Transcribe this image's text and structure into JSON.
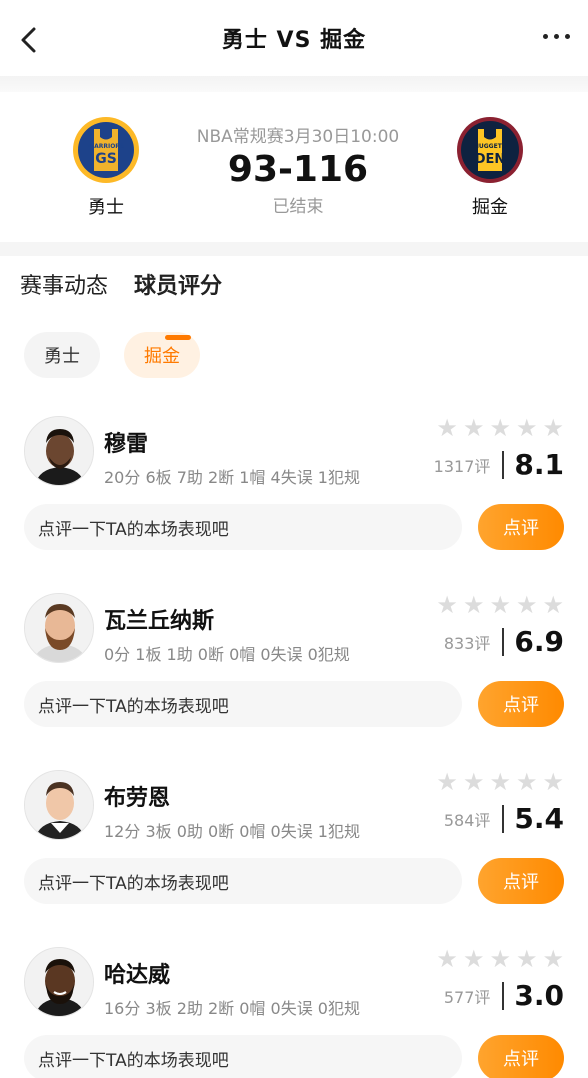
{
  "header": {
    "title": "勇士 VS 掘金"
  },
  "match": {
    "home_team": "勇士",
    "away_team": "掘金",
    "home_logo_text": "GS",
    "home_logo_small": "WARRIORS",
    "away_logo_text": "DEN",
    "away_logo_small": "NUGGETS",
    "meta": "NBA常规赛3月30日10:00",
    "score": "93-116",
    "status": "已结束"
  },
  "tabs": [
    {
      "label": "赛事动态",
      "active": false
    },
    {
      "label": "球员评分",
      "active": true
    }
  ],
  "team_filter": [
    {
      "label": "勇士",
      "active": false
    },
    {
      "label": "掘金",
      "active": true
    }
  ],
  "players": [
    {
      "name": "穆雷",
      "stats": "20分 6板 7助 2断 1帽 4失误 1犯规",
      "votes": "1317评",
      "rating": "8.1",
      "comment_placeholder": "点评一下TA的本场表现吧",
      "button": "点评"
    },
    {
      "name": "瓦兰丘纳斯",
      "stats": "0分 1板 1助 0断 0帽 0失误 0犯规",
      "votes": "833评",
      "rating": "6.9",
      "comment_placeholder": "点评一下TA的本场表现吧",
      "button": "点评"
    },
    {
      "name": "布劳恩",
      "stats": "12分 3板 0助 0断 0帽 0失误 1犯规",
      "votes": "584评",
      "rating": "5.4",
      "comment_placeholder": "点评一下TA的本场表现吧",
      "button": "点评"
    },
    {
      "name": "哈达威",
      "stats": "16分 3板 2助 2断 0帽 0失误 0犯规",
      "votes": "577评",
      "rating": "3.0",
      "comment_placeholder": "点评一下TA的本场表现吧",
      "button": "点评"
    }
  ],
  "colors": {
    "accent": "#ff7a00",
    "warriors_blue": "#1d428a",
    "warriors_gold": "#fdb927",
    "nuggets_navy": "#0e2240",
    "nuggets_red": "#8b2131",
    "nuggets_gold": "#fec524"
  }
}
